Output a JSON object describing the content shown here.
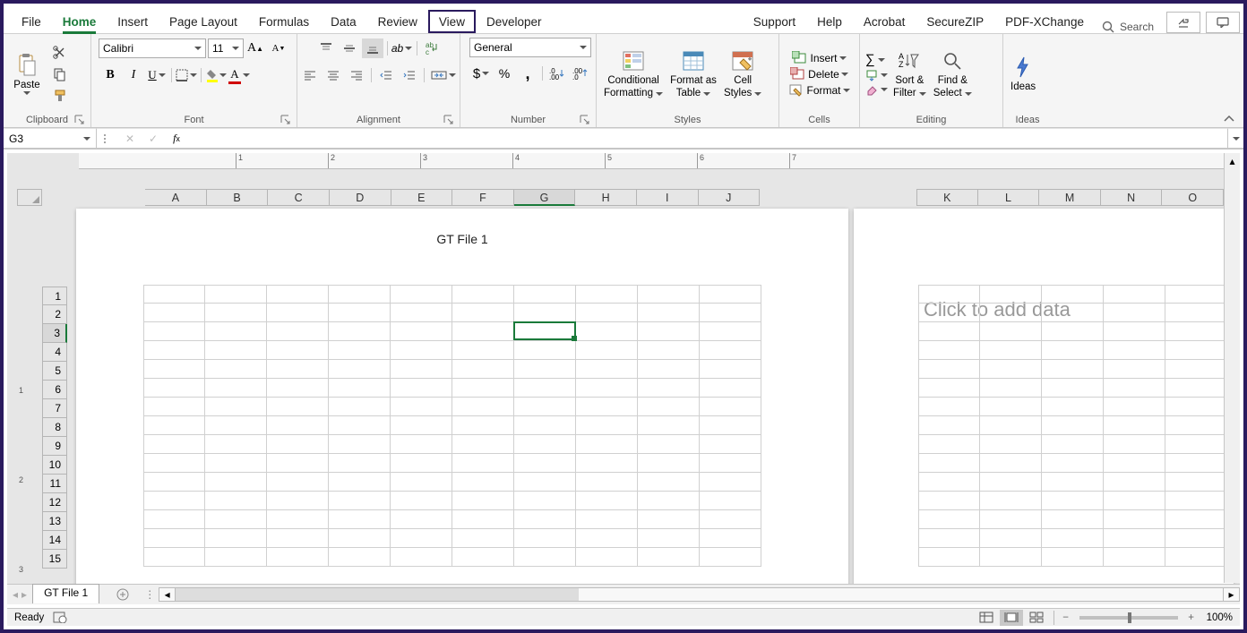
{
  "tabs": {
    "file": "File",
    "home": "Home",
    "insert": "Insert",
    "pagelayout": "Page Layout",
    "formulas": "Formulas",
    "data": "Data",
    "review": "Review",
    "view": "View",
    "developer": "Developer",
    "support": "Support",
    "help": "Help",
    "acrobat": "Acrobat",
    "securezip": "SecureZIP",
    "pdfxchange": "PDF-XChange",
    "search": "Search"
  },
  "groups": {
    "clipboard": "Clipboard",
    "font": "Font",
    "alignment": "Alignment",
    "number": "Number",
    "styles": "Styles",
    "cells": "Cells",
    "editing": "Editing",
    "ideas": "Ideas"
  },
  "clipboard": {
    "paste": "Paste"
  },
  "font": {
    "name": "Calibri",
    "size": "11"
  },
  "number": {
    "format": "General"
  },
  "styles": {
    "conditional1": "Conditional",
    "conditional2": "Formatting",
    "formatas1": "Format as",
    "formatas2": "Table",
    "cell1": "Cell",
    "cell2": "Styles"
  },
  "cells": {
    "insert": "Insert",
    "delete": "Delete",
    "format": "Format"
  },
  "editing": {
    "sort1": "Sort &",
    "sort2": "Filter",
    "find1": "Find &",
    "find2": "Select"
  },
  "ideas": {
    "label": "Ideas"
  },
  "namebox": "G3",
  "columns": [
    "A",
    "B",
    "C",
    "D",
    "E",
    "F",
    "G",
    "H",
    "I",
    "J",
    "K",
    "L",
    "M",
    "N",
    "O"
  ],
  "rows": [
    "1",
    "2",
    "3",
    "4",
    "5",
    "6",
    "7",
    "8",
    "9",
    "10",
    "11",
    "12",
    "13",
    "14",
    "15"
  ],
  "ruler_ticks": [
    "1",
    "2",
    "3",
    "4",
    "5",
    "6",
    "7"
  ],
  "vruler_ticks": [
    "1",
    "2",
    "3"
  ],
  "page_header": "GT File 1",
  "page2_placeholder": "Click to add data",
  "sheet_tab": "GT File 1",
  "status": {
    "ready": "Ready",
    "zoom": "100%"
  },
  "active_cell": "G3",
  "colwidths": {
    "main": 69,
    "page2": 69
  }
}
